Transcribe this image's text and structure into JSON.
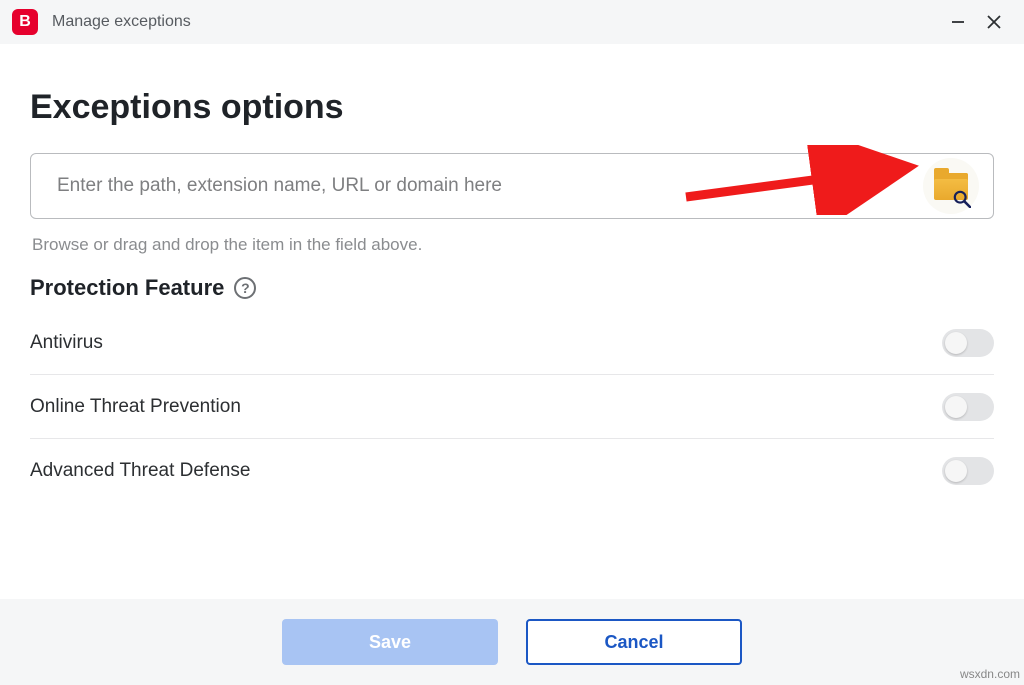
{
  "titlebar": {
    "logo_letter": "B",
    "title": "Manage exceptions"
  },
  "page": {
    "heading": "Exceptions options",
    "input_placeholder": "Enter the path, extension name, URL or domain here",
    "hint": "Browse or drag and drop the item in the field above.",
    "section_label": "Protection Feature"
  },
  "features": [
    {
      "label": "Antivirus",
      "enabled": false
    },
    {
      "label": "Online Threat Prevention",
      "enabled": false
    },
    {
      "label": "Advanced Threat Defense",
      "enabled": false
    }
  ],
  "footer": {
    "save_label": "Save",
    "cancel_label": "Cancel"
  },
  "watermark": "wsxdn.com"
}
